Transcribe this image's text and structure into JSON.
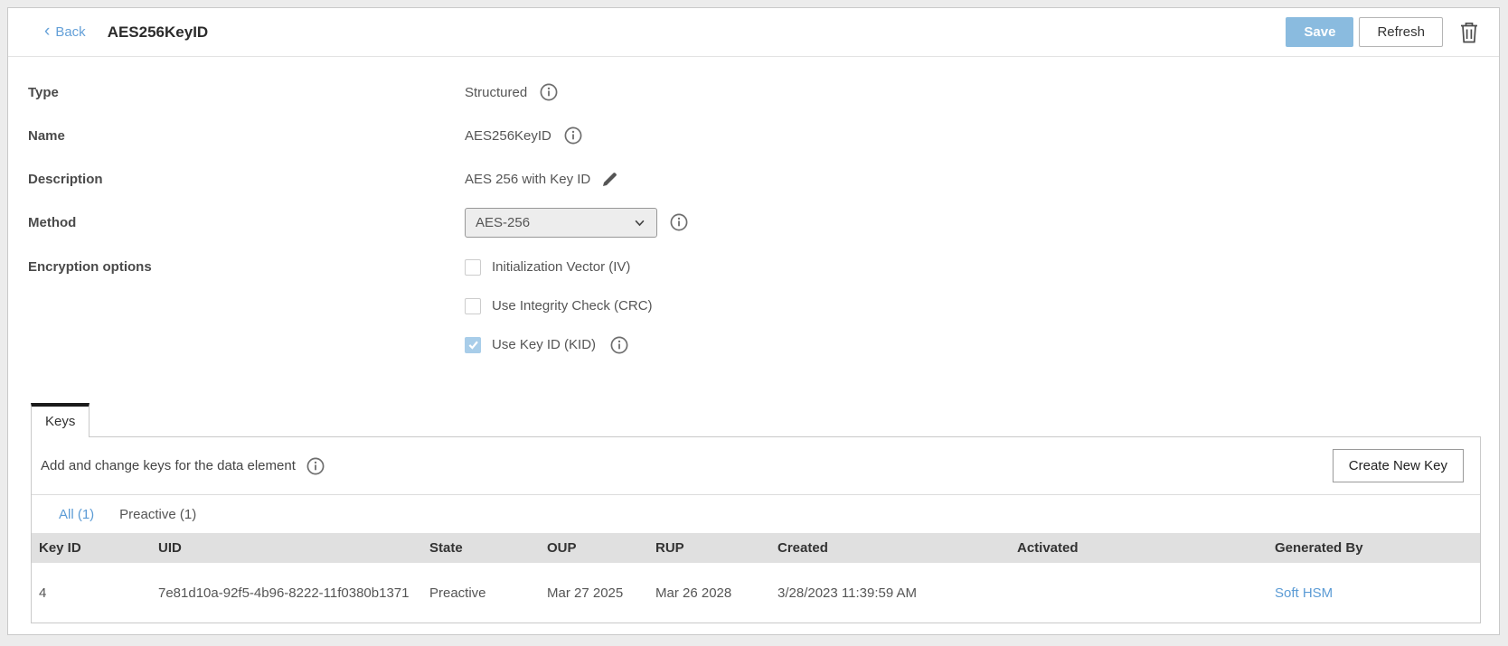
{
  "header": {
    "back_label": "Back",
    "title": "AES256KeyID",
    "save_label": "Save",
    "refresh_label": "Refresh"
  },
  "form": {
    "type": {
      "label": "Type",
      "value": "Structured"
    },
    "name": {
      "label": "Name",
      "value": "AES256KeyID"
    },
    "description": {
      "label": "Description",
      "value": "AES 256 with Key ID"
    },
    "method": {
      "label": "Method",
      "value": "AES-256"
    },
    "encryption": {
      "label": "Encryption options",
      "options": [
        {
          "label": "Initialization Vector (IV)",
          "checked": false
        },
        {
          "label": "Use Integrity Check (CRC)",
          "checked": false
        },
        {
          "label": "Use Key ID (KID)",
          "checked": true
        }
      ]
    }
  },
  "keys_panel": {
    "tab_label": "Keys",
    "description": "Add and change keys for the data element",
    "create_button_label": "Create New Key",
    "filters": [
      {
        "label": "All (1)",
        "active": true
      },
      {
        "label": "Preactive (1)",
        "active": false
      }
    ],
    "table": {
      "columns": [
        "Key ID",
        "UID",
        "State",
        "OUP",
        "RUP",
        "Created",
        "Activated",
        "Generated By"
      ],
      "rows": [
        {
          "key_id": "4",
          "uid": "7e81d10a-92f5-4b96-8222-11f0380b1371",
          "state": "Preactive",
          "oup": "Mar 27 2025",
          "rup": "Mar 26 2028",
          "created": "3/28/2023 11:39:59 AM",
          "activated": "",
          "generated_by": "Soft HSM"
        }
      ]
    }
  },
  "icons": {
    "back": "chevron-left",
    "info": "info-circle",
    "edit": "pencil",
    "dropdown": "chevron-down",
    "delete": "trash"
  },
  "colors": {
    "accent_link": "#5b9bd5",
    "save_button": "#8abbdf",
    "checked_checkbox": "#a8cde9",
    "table_header_bg": "#e0e0e0",
    "tab_accent": "#1b1b1b"
  }
}
